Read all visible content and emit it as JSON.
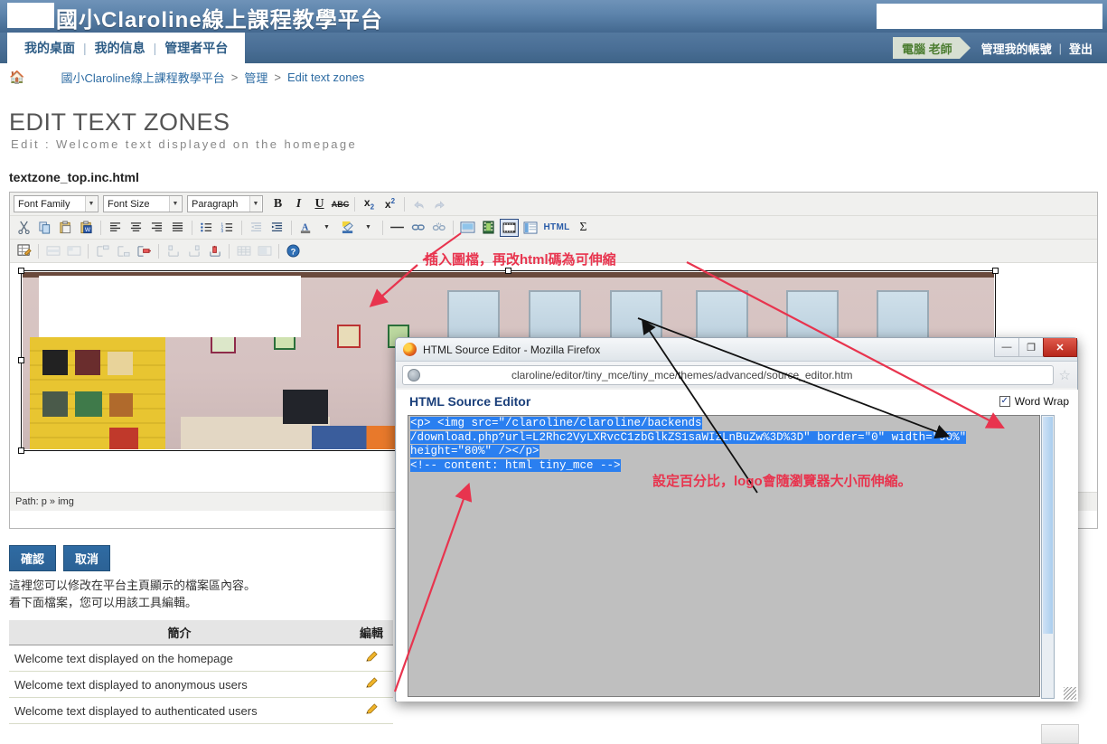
{
  "header": {
    "site_title": "國小Claroline線上課程教學平台",
    "user_name": "電腦 老師",
    "account_link": "管理我的帳號",
    "logout_link": "登出"
  },
  "nav": {
    "items": [
      {
        "label": "我的桌面"
      },
      {
        "label": "我的信息"
      },
      {
        "label": "管理者平台"
      }
    ],
    "separator": "|"
  },
  "breadcrumb": {
    "home_icon": "home-icon",
    "items": [
      {
        "label": "國小Claroline線上課程教學平台"
      },
      {
        "label": "管理"
      },
      {
        "label": "Edit text zones"
      }
    ],
    "separator": ">"
  },
  "page": {
    "title": "EDIT TEXT ZONES",
    "subtitle": "Edit : Welcome text displayed on the homepage",
    "file_name": "textzone_top.inc.html"
  },
  "editor": {
    "toolbar_row1": {
      "font_family": "Font Family",
      "font_size": "Font Size",
      "paragraph": "Paragraph",
      "buttons": [
        {
          "name": "bold-button",
          "glyph": "B"
        },
        {
          "name": "italic-button",
          "glyph": "I"
        },
        {
          "name": "underline-button",
          "glyph": "U"
        },
        {
          "name": "strikethrough-button",
          "glyph": "ABC"
        },
        {
          "name": "subscript-button",
          "glyph": "x₂"
        },
        {
          "name": "superscript-button",
          "glyph": "x²"
        },
        {
          "name": "undo-button",
          "glyph": "↶"
        },
        {
          "name": "redo-button",
          "glyph": "↷"
        }
      ]
    },
    "toolbar_row2": {
      "buttons": [
        {
          "name": "cut-button"
        },
        {
          "name": "copy-button"
        },
        {
          "name": "paste-button"
        },
        {
          "name": "paste-from-word-button"
        },
        {
          "name": "align-left-button"
        },
        {
          "name": "align-center-button"
        },
        {
          "name": "align-right-button"
        },
        {
          "name": "align-justify-button"
        },
        {
          "name": "bullet-list-button"
        },
        {
          "name": "numbered-list-button"
        },
        {
          "name": "outdent-button"
        },
        {
          "name": "indent-button"
        },
        {
          "name": "text-color-button"
        },
        {
          "name": "background-color-button"
        },
        {
          "name": "horizontal-rule-button"
        },
        {
          "name": "insert-link-button"
        },
        {
          "name": "unlink-button"
        },
        {
          "name": "insert-image-button"
        },
        {
          "name": "insert-media-button"
        },
        {
          "name": "insert-film-button"
        },
        {
          "name": "insert-template-button"
        },
        {
          "name": "edit-html-source-button",
          "glyph": "HTML"
        },
        {
          "name": "insert-formula-button",
          "glyph": "Σ"
        }
      ]
    },
    "toolbar_row3": {
      "buttons": [
        {
          "name": "table-properties-button"
        },
        {
          "name": "row-properties-button"
        },
        {
          "name": "cell-properties-button"
        },
        {
          "name": "insert-row-before-button"
        },
        {
          "name": "insert-row-after-button"
        },
        {
          "name": "delete-row-button"
        },
        {
          "name": "insert-column-before-button"
        },
        {
          "name": "insert-column-after-button"
        },
        {
          "name": "delete-column-button"
        },
        {
          "name": "split-cells-button"
        },
        {
          "name": "merge-cells-button"
        },
        {
          "name": "help-button"
        }
      ]
    },
    "path_label": "Path: p » img"
  },
  "actions": {
    "confirm": "確認",
    "cancel": "取消"
  },
  "help_text": {
    "line1": "這裡您可以修改在平台主頁顯示的檔案區內容。",
    "line2": "看下面檔案，您可以用該工具編輯。"
  },
  "table": {
    "headers": [
      "簡介",
      "編輯"
    ],
    "rows": [
      {
        "description": "Welcome text displayed on the homepage",
        "edit_icon": "pencil-icon"
      },
      {
        "description": "Welcome text displayed to anonymous users",
        "edit_icon": "pencil-icon"
      },
      {
        "description": "Welcome text displayed to authenticated users",
        "edit_icon": "pencil-icon"
      }
    ]
  },
  "dialog": {
    "title": "HTML Source Editor - Mozilla Firefox",
    "minimize": "—",
    "maximize": "❐",
    "close": "✕",
    "url": "claroline/editor/tiny_mce/tiny_mce/themes/advanced/source_editor.htm",
    "heading": "HTML Source Editor",
    "word_wrap_label": "Word Wrap",
    "word_wrap_checked": "✓",
    "code_line1": "<p> <img src=\"/claroline/claroline/backends",
    "code_line2": "/download.php?url=L2Rhc2VyLXRvcC1zbGlkZS1saWIzLnBuZw%3D%3D\" border=\"0\" width=\"90%\"",
    "code_line3": "height=\"80%\" /></p>",
    "code_line4": "<!-- content: html tiny_mce -->"
  },
  "annotations": [
    {
      "name": "annotation-insert-image",
      "text": "插入圖檔，再改html碼為可伸縮",
      "color": "#e8344e"
    },
    {
      "name": "annotation-percent-scaling",
      "text": "設定百分比，logo會隨瀏覽器大小而伸縮。",
      "color": "#e8344e"
    }
  ]
}
